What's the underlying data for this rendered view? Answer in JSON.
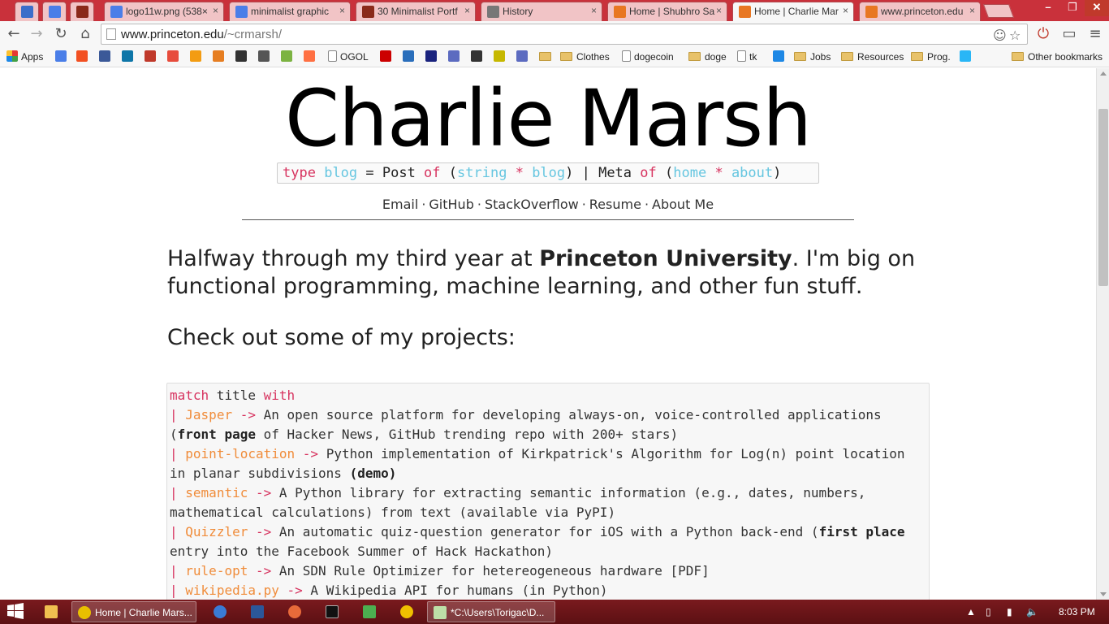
{
  "browser": {
    "tabs": [
      {
        "label": "",
        "favicon": "i-icon",
        "color": "#3b6ec9"
      },
      {
        "label": "",
        "favicon": "google-icon",
        "color": "#4a7ee8"
      },
      {
        "label": "",
        "favicon": "c-icon",
        "color": "#8a2a1a"
      },
      {
        "label": "logo11w.png (538×",
        "favicon": "google-icon",
        "color": "#4a7ee8"
      },
      {
        "label": "minimalist graphic",
        "favicon": "google-icon",
        "color": "#4a7ee8"
      },
      {
        "label": "30 Minimalist Portf",
        "favicon": "sr-icon",
        "color": "#8a2a1a"
      },
      {
        "label": "History",
        "favicon": "history-icon",
        "color": "#777777"
      },
      {
        "label": "Home | Shubhro Sa",
        "favicon": "princeton-icon",
        "color": "#e87722"
      },
      {
        "label": "Home | Charlie Mar",
        "favicon": "princeton-icon",
        "color": "#e87722"
      },
      {
        "label": "www.princeton.edu",
        "favicon": "princeton-icon",
        "color": "#e87722"
      }
    ],
    "url_host": "www.princeton.edu",
    "url_path": "/~crmarsh/",
    "bookmarks": [
      {
        "label": "Apps",
        "type": "apps"
      },
      {
        "label": "",
        "type": "icon",
        "color": "#4a7ee8"
      },
      {
        "label": "",
        "type": "icon",
        "color": "#f25022"
      },
      {
        "label": "",
        "type": "icon",
        "color": "#3b5998"
      },
      {
        "label": "",
        "type": "icon",
        "color": "#0e76a8"
      },
      {
        "label": "",
        "type": "icon",
        "color": "#c0392b"
      },
      {
        "label": "",
        "type": "icon",
        "color": "#e74c3c"
      },
      {
        "label": "",
        "type": "icon",
        "color": "#f39c12"
      },
      {
        "label": "",
        "type": "icon",
        "color": "#e67e22"
      },
      {
        "label": "",
        "type": "icon",
        "color": "#333333"
      },
      {
        "label": "",
        "type": "icon",
        "color": "#555555"
      },
      {
        "label": "",
        "type": "icon",
        "color": "#7cb342"
      },
      {
        "label": "",
        "type": "icon",
        "color": "#ff7043"
      },
      {
        "label": "OGOL",
        "type": "page"
      },
      {
        "label": "",
        "type": "icon",
        "color": "#cc0000"
      },
      {
        "label": "",
        "type": "icon",
        "color": "#2a6ebb"
      },
      {
        "label": "",
        "type": "icon",
        "color": "#1a237e"
      },
      {
        "label": "",
        "type": "icon",
        "color": "#5c6bc0"
      },
      {
        "label": "",
        "type": "icon",
        "color": "#333333"
      },
      {
        "label": "",
        "type": "icon",
        "color": "#c6b800"
      },
      {
        "label": "",
        "type": "icon",
        "color": "#5c6bc0"
      },
      {
        "label": "",
        "type": "folder"
      },
      {
        "label": "Clothes",
        "type": "folder"
      },
      {
        "label": "dogecoin",
        "type": "page"
      },
      {
        "label": "doge",
        "type": "folder"
      },
      {
        "label": "tk",
        "type": "page"
      },
      {
        "label": "",
        "type": "icon",
        "color": "#1e88e5"
      },
      {
        "label": "Jobs",
        "type": "folder"
      },
      {
        "label": "Resources",
        "type": "folder"
      },
      {
        "label": "Prog.",
        "type": "folder"
      },
      {
        "label": "",
        "type": "icon",
        "color": "#29b6f6"
      },
      {
        "label": "Other bookmarks",
        "type": "folder"
      }
    ]
  },
  "page": {
    "title": "Charlie Marsh",
    "type_sig": [
      {
        "t": "type",
        "c": "kw"
      },
      {
        "t": " ",
        "c": "plain"
      },
      {
        "t": "blog",
        "c": "ty"
      },
      {
        "t": " = Post ",
        "c": "plain"
      },
      {
        "t": "of",
        "c": "kw"
      },
      {
        "t": " (",
        "c": "plain"
      },
      {
        "t": "string",
        "c": "ty"
      },
      {
        "t": " ",
        "c": "plain"
      },
      {
        "t": "*",
        "c": "kw"
      },
      {
        "t": " ",
        "c": "plain"
      },
      {
        "t": "blog",
        "c": "ty"
      },
      {
        "t": ") | Meta ",
        "c": "plain"
      },
      {
        "t": "of",
        "c": "kw"
      },
      {
        "t": " (",
        "c": "plain"
      },
      {
        "t": "home",
        "c": "ty"
      },
      {
        "t": " ",
        "c": "plain"
      },
      {
        "t": "*",
        "c": "kw"
      },
      {
        "t": " ",
        "c": "plain"
      },
      {
        "t": "about",
        "c": "ty"
      },
      {
        "t": ")",
        "c": "plain"
      }
    ],
    "nav_links": [
      "Email",
      "GitHub",
      "StackOverflow",
      "Resume",
      "About Me"
    ],
    "nav_separator": "·",
    "intro_before": "Halfway through my third year at ",
    "intro_bold": "Princeton University",
    "intro_after": ". I'm big on functional programming, machine learning, and other fun stuff.",
    "projects_heading": "Check out some of my projects:",
    "code_header_kw1": "match",
    "code_header_mid": " title ",
    "code_header_kw2": "with",
    "projects": [
      {
        "name": "Jasper",
        "desc": [
          {
            "t": "An open source platform for developing always-on, voice-controlled applications ("
          },
          {
            "t": "front page",
            "b": true
          },
          {
            "t": " of Hacker News, GitHub trending repo with 200+ stars)"
          }
        ]
      },
      {
        "name": "point-location",
        "desc": [
          {
            "t": "Python implementation of Kirkpatrick's Algorithm for Log(n) point location in planar subdivisions "
          },
          {
            "t": "(demo)",
            "b": true
          }
        ]
      },
      {
        "name": "semantic",
        "desc": [
          {
            "t": "A Python library for extracting semantic information (e.g., dates, numbers, mathematical calculations) from text (available via PyPI)"
          }
        ]
      },
      {
        "name": "Quizzler",
        "desc": [
          {
            "t": "An automatic quiz-question generator for iOS with a Python back-end ("
          },
          {
            "t": "first place",
            "b": true
          },
          {
            "t": " entry into the Facebook Summer of Hack Hackathon)"
          }
        ]
      },
      {
        "name": "rule-opt",
        "desc": [
          {
            "t": "An SDN Rule Optimizer for hetereogeneous hardware [PDF]"
          }
        ]
      },
      {
        "name": "wikipedia.py",
        "desc": [
          {
            "t": "A Wikipedia API for humans (in Python)"
          }
        ]
      }
    ],
    "pipe": "|",
    "arrow": "->"
  },
  "taskbar": {
    "windows": [
      {
        "label": "Home | Charlie Mars...",
        "icon": "chrome-icon",
        "color": "#e8c000"
      },
      {
        "label": "*C:\\Users\\Torigac\\D...",
        "icon": "notepad-icon",
        "color": "#bde0a8"
      }
    ],
    "clock": "8:03 PM"
  }
}
